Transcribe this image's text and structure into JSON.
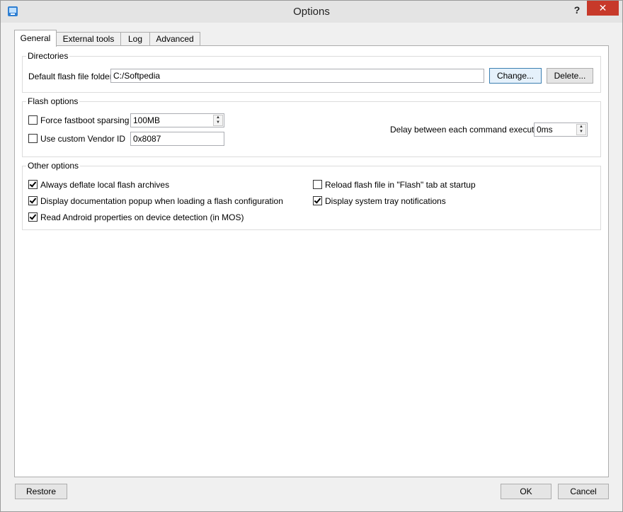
{
  "window": {
    "title": "Options",
    "help": "?",
    "close": "✕"
  },
  "tabs": [
    "General",
    "External tools",
    "Log",
    "Advanced"
  ],
  "directories": {
    "title": "Directories",
    "label": "Default flash file folder",
    "value": "C:/Softpedia",
    "change_button": "Change...",
    "delete_button": "Delete..."
  },
  "flash_options": {
    "title": "Flash options",
    "force_sparsing": {
      "label": "Force fastboot sparsing",
      "checked": false,
      "value": "100MB"
    },
    "vendor_id": {
      "label": "Use custom Vendor ID",
      "checked": false,
      "value": "0x8087"
    },
    "delay": {
      "label": "Delay between each command execution",
      "value": "0ms"
    }
  },
  "other_options": {
    "title": "Other options",
    "items": [
      {
        "label": "Always deflate local flash archives",
        "checked": true
      },
      {
        "label": "Display documentation popup when loading a flash configuration",
        "checked": true
      },
      {
        "label": "Read Android properties on device detection (in MOS)",
        "checked": true
      },
      {
        "label": "Reload flash file in \"Flash\" tab at startup",
        "checked": false
      },
      {
        "label": "Display system tray notifications",
        "checked": true
      }
    ]
  },
  "footer": {
    "restore": "Restore",
    "ok": "OK",
    "cancel": "Cancel"
  },
  "colors": {
    "close_button": "#c7392a",
    "default_button_border": "#3c7fb1"
  }
}
